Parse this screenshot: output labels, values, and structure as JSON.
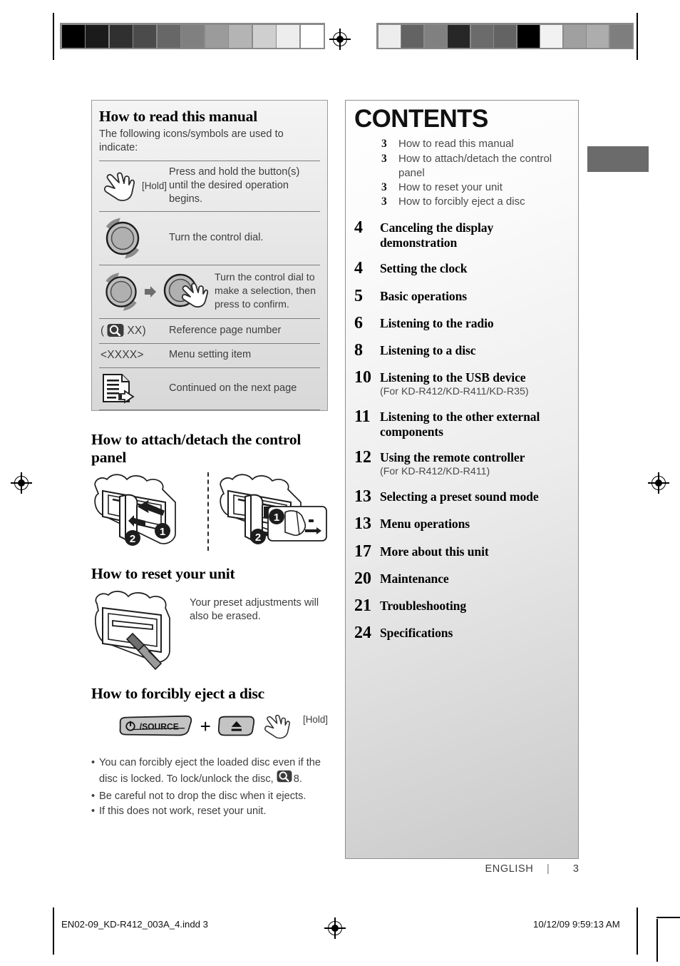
{
  "calibration": {
    "left_bar": [
      "#000000",
      "#1b1b1b",
      "#303030",
      "#4b4b4b",
      "#676767",
      "#808080",
      "#9b9b9b",
      "#b4b4b4",
      "#cfcfcf",
      "#ededed",
      "#ffffff"
    ],
    "right_bar": [
      "#ededed",
      "#636363",
      "#808080",
      "#272727",
      "#6b6b6b",
      "#636363",
      "#000000",
      "#f2f2f2",
      "#a0a0a0",
      "#adadad",
      "#7e7e7e"
    ],
    "thumb_tab_color": "#6b6b6b"
  },
  "how_to_read": {
    "title": "How to read this manual",
    "subtitle": "The following icons/symbols are used to indicate:",
    "rows": [
      {
        "icon": "hand-press-icon",
        "icon_label": "[Hold]",
        "text": "Press and hold the button(s) until the desired operation begins."
      },
      {
        "icon": "control-dial-icon",
        "icon_label": "",
        "text": "Turn the control dial."
      },
      {
        "icon": "control-dial-then-press-icon",
        "icon_label": "",
        "text": "Turn the control dial to make a selection, then press to confirm."
      },
      {
        "icon": "magnifier-icon",
        "icon_label": "( XX)",
        "icon_label_prefix": "(",
        "icon_label_suffix": "XX)",
        "text": "Reference page number"
      },
      {
        "icon": "angle-brackets",
        "icon_label": "<XXXX>",
        "text": "Menu setting item"
      },
      {
        "icon": "continued-page-icon",
        "icon_label": "",
        "text": "Continued on the next page"
      }
    ]
  },
  "attach_detach": {
    "title": "How to attach/detach the control panel",
    "figure_left_labels": [
      "1",
      "2"
    ],
    "figure_right_labels": [
      "1",
      "2"
    ]
  },
  "reset_unit": {
    "title": "How to reset your unit",
    "note": "Your preset adjustments will also be erased."
  },
  "eject_disc": {
    "title": "How to forcibly eject a disc",
    "source_button_label": "/SOURCE",
    "plus": "+",
    "eject_button_label": "eject-icon",
    "hold_label": "[Hold]",
    "bullets": [
      {
        "text_before": "You can forcibly eject the loaded disc even if the disc is locked. To lock/unlock the disc,",
        "has_magnifier": true,
        "text_after": "8."
      },
      {
        "text_before": "Be careful not to drop the disc when it ejects.",
        "has_magnifier": false,
        "text_after": ""
      },
      {
        "text_before": "If this does not work, reset your unit.",
        "has_magnifier": false,
        "text_after": ""
      }
    ]
  },
  "contents": {
    "title": "CONTENTS",
    "sub_entries": [
      {
        "page": "3",
        "label": "How to read this manual"
      },
      {
        "page": "3",
        "label": "How to attach/detach the control panel"
      },
      {
        "page": "3",
        "label": "How to reset your unit"
      },
      {
        "page": "3",
        "label": "How to forcibly eject a disc"
      }
    ],
    "main_entries": [
      {
        "page": "4",
        "label": "Canceling the display demonstration",
        "note": ""
      },
      {
        "page": "4",
        "label": "Setting the clock",
        "note": ""
      },
      {
        "page": "5",
        "label": "Basic operations",
        "note": ""
      },
      {
        "page": "6",
        "label": "Listening to the radio",
        "note": ""
      },
      {
        "page": "8",
        "label": "Listening to a disc",
        "note": ""
      },
      {
        "page": "10",
        "label": "Listening to the USB device",
        "note": "(For KD-R412/KD-R411/KD-R35)"
      },
      {
        "page": "11",
        "label": "Listening to the other external components",
        "note": ""
      },
      {
        "page": "12",
        "label": "Using the remote controller",
        "note": "(For KD-R412/KD-R411)"
      },
      {
        "page": "13",
        "label": "Selecting a preset sound mode",
        "note": ""
      },
      {
        "page": "13",
        "label": "Menu operations",
        "note": ""
      },
      {
        "page": "17",
        "label": "More about this unit",
        "note": ""
      },
      {
        "page": "20",
        "label": "Maintenance",
        "note": ""
      },
      {
        "page": "21",
        "label": "Troubleshooting",
        "note": ""
      },
      {
        "page": "24",
        "label": "Specifications",
        "note": ""
      }
    ]
  },
  "footer": {
    "language": "ENGLISH",
    "separator": "|",
    "page_number": "3",
    "imprint_file": "EN02-09_KD-R412_003A_4.indd   3",
    "imprint_stamp": "10/12/09   9:59:13 AM"
  }
}
